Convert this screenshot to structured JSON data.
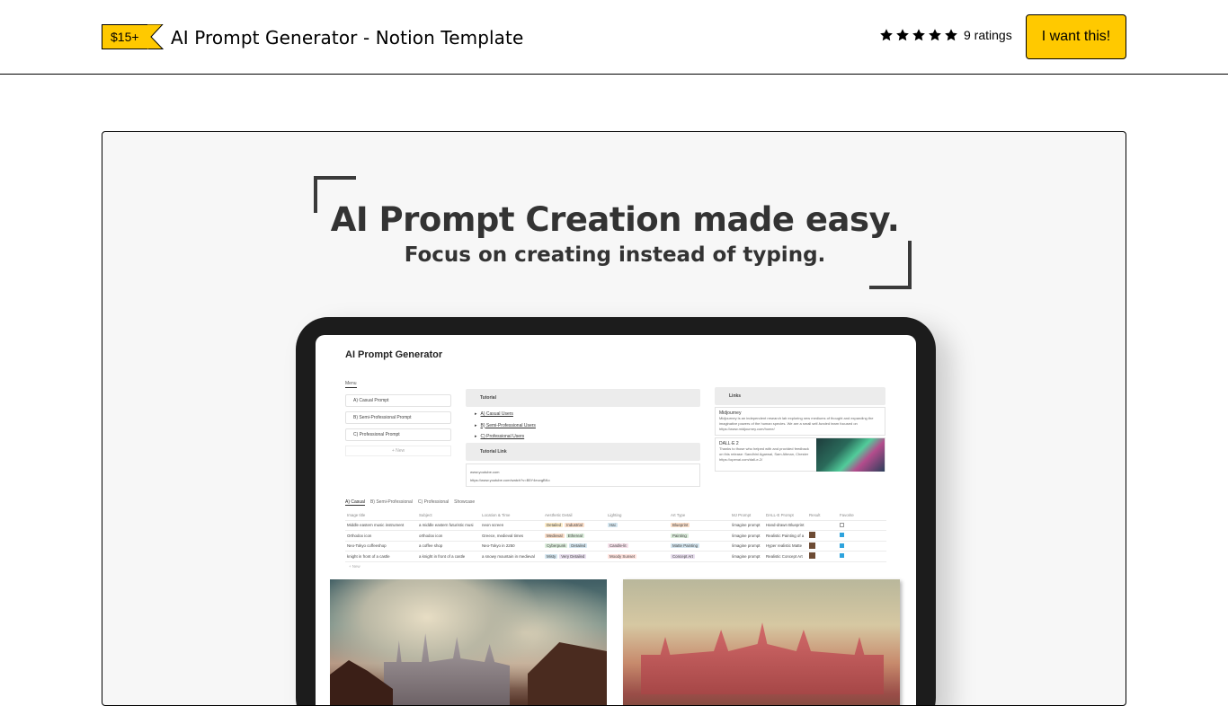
{
  "header": {
    "price": "$15+",
    "product_title": "AI Prompt Generator - Notion Template",
    "star_count": 5,
    "ratings_text": "9 ratings",
    "buy_label": "I want this!",
    "accent_color": "#ffc900"
  },
  "hero": {
    "headline": "AI Prompt Creation made easy.",
    "subheadline": "Focus on creating instead of typing."
  },
  "notion": {
    "title": "AI Prompt Generator",
    "menu_tab": "Menu",
    "menu_items": [
      "A) Casual Prompt",
      "B) Semi-Professional Prompt",
      "C) Professional Prompt"
    ],
    "menu_new": "+ New",
    "tutorial_heading": "Tutorial",
    "tutorial_links": [
      "A) Casual Users",
      "B) Semi-Professional Users",
      "C) Professional Users"
    ],
    "tutorial_link_heading": "Tutorial Link",
    "tutorial_url_title": "www.youtube.com",
    "tutorial_url": "https://www.youtube.com/watch?v=B5Y4euvgBKo",
    "links_heading": "Links",
    "midjourney_title": "Midjourney",
    "midjourney_desc": "Midjourney is an independent research lab exploring new mediums of thought and expanding the imaginative powers of the human species. We are a small self-funded team focused on",
    "midjourney_url": "https://www.midjourney.com/home/",
    "dalle_title": "DALL·E 2",
    "dalle_desc": "Thanks to those who helped with and provided feedback on this release: Sandhini Agarwal, Sam Altman, Chester",
    "dalle_url": "https://openai.com/dall-e-2/",
    "db_tabs": [
      "A) Casual",
      "B) Semi-Professional",
      "C) Professional",
      "Showcase"
    ],
    "table_headers": [
      "Image title",
      "Subject",
      "Location & Time",
      "Aesthetic Detail",
      "Lighting",
      "Art Type",
      "MJ Prompt",
      "DALL-E Prompt",
      "Result",
      "Favorite"
    ],
    "rows": [
      {
        "title": "Middle eastern music instrument",
        "subject": "a middle eastern futuristic musi",
        "location": "neon screen",
        "aesthetic": [
          "Detailed",
          "Industrial"
        ],
        "lighting": [
          "Hai"
        ],
        "art": [
          "Blueprint"
        ],
        "mj": "/imagine prompt",
        "dalle": "Hand-drawn Blueprint",
        "favorite": false
      },
      {
        "title": "Orthodox icon",
        "subject": "orthodox icon",
        "location": "Greece, medieval times",
        "aesthetic": [
          "Medieval",
          "Ethereal"
        ],
        "lighting": [],
        "art": [
          "Painting"
        ],
        "mj": "/imagine prompt",
        "dalle": "Realistic Painting of a",
        "favorite": true
      },
      {
        "title": "Neo-Tokyo coffeeshop",
        "subject": "a coffee shop",
        "location": "Neo-Tokyo in 2250",
        "aesthetic": [
          "Cyberpunk",
          "Detailed"
        ],
        "lighting": [
          "Candle-lit"
        ],
        "art": [
          "Matte Painting"
        ],
        "mj": "/imagine prompt",
        "dalle": "Hyper realistic Matte",
        "favorite": true
      },
      {
        "title": "knight in front of a castle",
        "subject": "a knight in front of a castle",
        "location": "a snowy mountain in medieval",
        "aesthetic": [
          "Misty",
          "Very Detailed"
        ],
        "lighting": [
          "Moody Sunset"
        ],
        "art": [
          "Concept Art"
        ],
        "mj": "/imagine prompt",
        "dalle": "Realistic Concept Art",
        "favorite": true
      }
    ],
    "table_new": "+ New"
  }
}
